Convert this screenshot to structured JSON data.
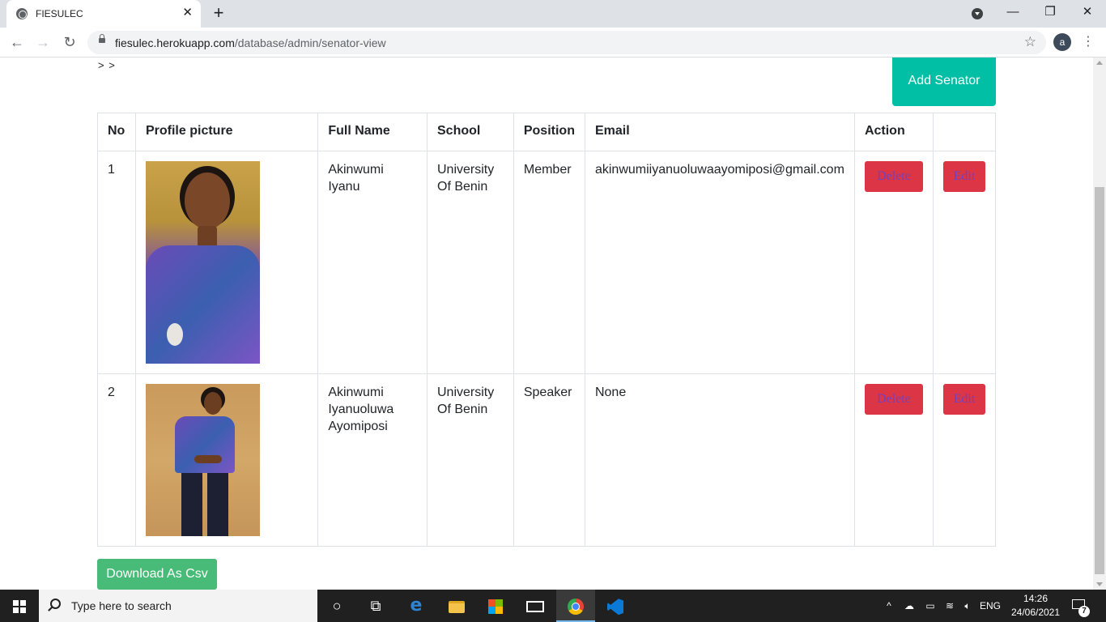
{
  "browser": {
    "tab_title": "FIESULEC",
    "url_host": "fiesulec.herokuapp.com",
    "url_path": "/database/admin/senator-view",
    "avatar_letter": "a"
  },
  "page": {
    "breadcrumb": "> >",
    "add_button": "Add Senator",
    "download_button": "Download As Csv",
    "colors": {
      "add_button": "#00bfa5",
      "download_button": "#48bb78",
      "action_button": "#dc3545",
      "action_text": "#6f42c1"
    }
  },
  "table": {
    "headers": [
      "No",
      "Profile picture",
      "Full Name",
      "School",
      "Position",
      "Email",
      "Action",
      ""
    ],
    "rows": [
      {
        "no": "1",
        "full_name": "Akinwumi Iyanu",
        "school": "University Of Benin",
        "position": "Member",
        "email": "akinwumiiyanuoluwaayomiposi@gmail.com",
        "delete": "Delete",
        "edit": "Edit"
      },
      {
        "no": "2",
        "full_name": "Akinwumi Iyanuoluwa Ayomiposi",
        "school": "University Of Benin",
        "position": "Speaker",
        "email": "None",
        "delete": "Delete",
        "edit": "Edit"
      }
    ]
  },
  "taskbar": {
    "search_placeholder": "Type here to search",
    "language": "ENG",
    "time": "14:26",
    "date": "24/06/2021",
    "notification_count": "7"
  }
}
